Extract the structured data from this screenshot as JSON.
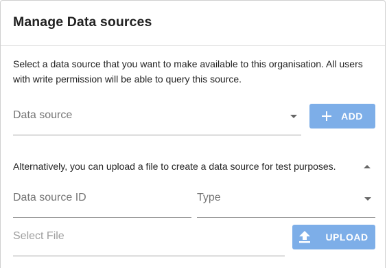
{
  "dialog": {
    "title": "Manage Data sources",
    "description": "Select a data source that you want to make available to this organisation. All users with write permission will be able to query this source."
  },
  "data_source_select": {
    "label": "Data source"
  },
  "add_button": {
    "label": "ADD",
    "icon": "plus-icon"
  },
  "upload_section": {
    "text": "Alternatively, you can upload a file to create a data source for test purposes.",
    "collapse_icon": "chevron-up-icon",
    "id_field_label": "Data source ID",
    "type_field_label": "Type",
    "file_field_placeholder": "Select File",
    "upload_button_label": "UPLOAD",
    "upload_icon": "upload-icon"
  },
  "colors": {
    "button_bg": "#7daee8",
    "button_text": "#ffffff",
    "divider": "#e0e0e0",
    "field_underline": "#9e9e9e"
  }
}
